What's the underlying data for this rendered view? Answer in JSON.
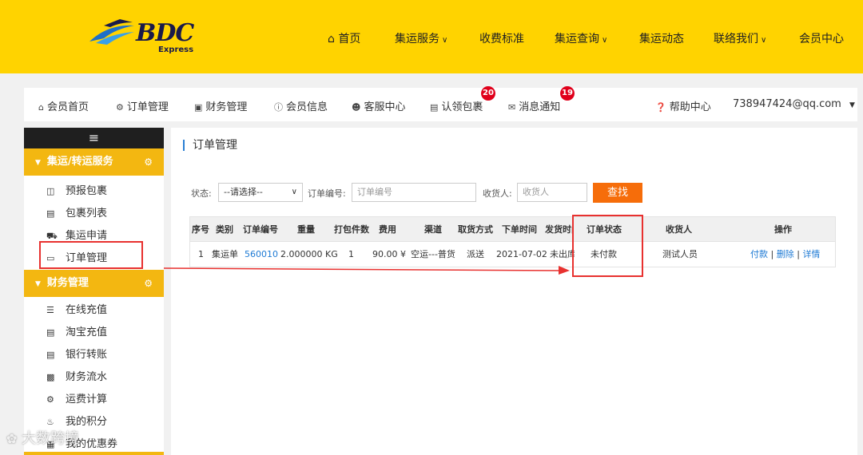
{
  "logo": {
    "text": "BDC",
    "sub": "Express"
  },
  "nav": {
    "home": "首页",
    "service": "集运服务",
    "fees": "收费标准",
    "query": "集运查询",
    "news": "集运动态",
    "contact": "联络我们",
    "member": "会员中心"
  },
  "memberbar": {
    "home": "会员首页",
    "orders": "订单管理",
    "finance": "财务管理",
    "info": "会员信息",
    "service": "客服中心",
    "claim": "认领包裹",
    "claim_badge": "20",
    "messages": "消息通知",
    "messages_badge": "19",
    "help": "帮助中心",
    "account": "738947424@qq.com"
  },
  "sidebar": {
    "menu_icon": "≡",
    "group1": "集运/转运服务",
    "items1": [
      "预报包裹",
      "包裹列表",
      "集运申请",
      "订单管理"
    ],
    "group2": "财务管理",
    "items2": [
      "在线充值",
      "淘宝充值",
      "银行转账",
      "财务流水",
      "运费计算",
      "我的积分",
      "我的优惠券"
    ]
  },
  "main": {
    "title": "订单管理",
    "filters": {
      "status_label": "状态:",
      "status_value": "--请选择--",
      "order_label": "订单编号:",
      "order_placeholder": "订单编号",
      "receiver_label": "收货人:",
      "receiver_placeholder": "收货人",
      "search_btn": "查找"
    },
    "table": {
      "headers": [
        "序号",
        "类别",
        "订单编号",
        "重量",
        "打包件数",
        "费用",
        "渠道",
        "取货方式",
        "下单时间",
        "发货时间",
        "订单状态",
        "收货人",
        "操作"
      ],
      "rows": [
        {
          "index": "1",
          "type": "集运单",
          "order_no": "560010",
          "weight": "2.000000 KG",
          "packages": "1",
          "fee": "90.00 ¥",
          "channel": "空运---普货",
          "pickup": "派送",
          "order_time": "2021-07-02",
          "ship_time": "未出库",
          "status": "未付款",
          "receiver": "测试人员",
          "ops": [
            "付款",
            "删除",
            "详情"
          ]
        }
      ]
    }
  },
  "watermark": "大数跨境",
  "colors": {
    "header": "#ffd300",
    "sidebar_group": "#f3b711",
    "search": "#f66d0a",
    "link": "#1e7ad4",
    "highlight": "#e8312f"
  }
}
